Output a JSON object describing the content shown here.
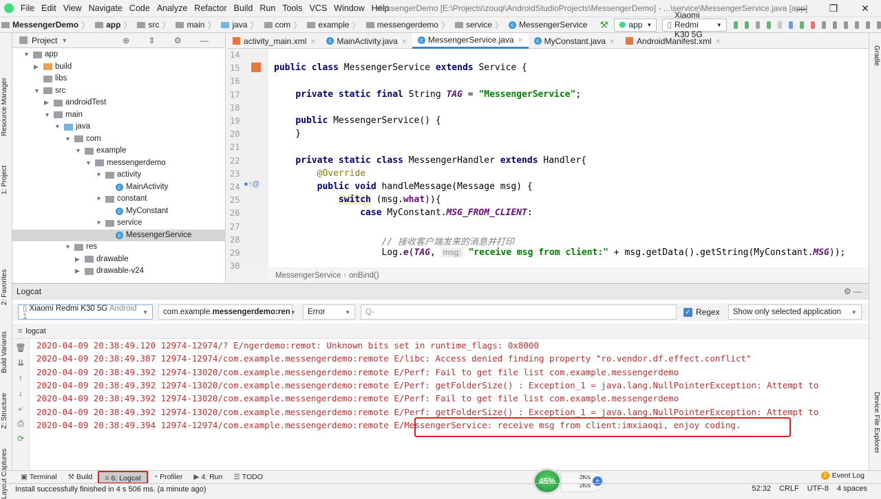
{
  "menu": [
    "File",
    "Edit",
    "View",
    "Navigate",
    "Code",
    "Analyze",
    "Refactor",
    "Build",
    "Run",
    "Tools",
    "VCS",
    "Window",
    "Help"
  ],
  "window_title": "MessengerDemo [E:\\Projects\\zouqi\\AndroidStudioProjects\\MessengerDemo] - ...\\service\\MessengerService.java [app]",
  "breadcrumb": [
    "MessengerDemo",
    "app",
    "src",
    "main",
    "java",
    "com",
    "example",
    "messengerdemo",
    "service",
    "MessengerService"
  ],
  "toolbar": {
    "run_config": "app",
    "device": "Xiaomi Redmi K30 5G"
  },
  "left_strip": [
    "Resource Manager",
    "1: Project",
    "2: Favorites",
    "Build Variants",
    "Z: Structure",
    "Layout Captures"
  ],
  "right_strip": [
    "Gradle",
    "Device File Explorer"
  ],
  "project": {
    "header": "Project",
    "tree": [
      {
        "label": "app",
        "level": 0,
        "type": "module",
        "open": true
      },
      {
        "label": "build",
        "level": 1,
        "type": "folder-orange",
        "open": false
      },
      {
        "label": "libs",
        "level": 1,
        "type": "folder",
        "open": null
      },
      {
        "label": "src",
        "level": 1,
        "type": "folder",
        "open": true
      },
      {
        "label": "androidTest",
        "level": 2,
        "type": "folder",
        "open": false
      },
      {
        "label": "main",
        "level": 2,
        "type": "folder",
        "open": true
      },
      {
        "label": "java",
        "level": 3,
        "type": "folder-blue",
        "open": true
      },
      {
        "label": "com",
        "level": 4,
        "type": "folder",
        "open": true
      },
      {
        "label": "example",
        "level": 5,
        "type": "folder",
        "open": true
      },
      {
        "label": "messengerdemo",
        "level": 6,
        "type": "folder",
        "open": true
      },
      {
        "label": "activity",
        "level": 7,
        "type": "folder",
        "open": true
      },
      {
        "label": "MainActivity",
        "level": 8,
        "type": "class",
        "open": null
      },
      {
        "label": "constant",
        "level": 7,
        "type": "folder",
        "open": true
      },
      {
        "label": "MyConstant",
        "level": 8,
        "type": "class",
        "open": null
      },
      {
        "label": "service",
        "level": 7,
        "type": "folder",
        "open": true
      },
      {
        "label": "MessengerService",
        "level": 8,
        "type": "class",
        "open": null,
        "selected": true
      },
      {
        "label": "res",
        "level": 4,
        "type": "folder",
        "open": true
      },
      {
        "label": "drawable",
        "level": 5,
        "type": "folder",
        "open": false
      },
      {
        "label": "drawable-v24",
        "level": 5,
        "type": "folder",
        "open": false
      }
    ]
  },
  "tabs": [
    {
      "label": "activity_main.xml"
    },
    {
      "label": "MainActivity.java"
    },
    {
      "label": "MessengerService.java",
      "active": true
    },
    {
      "label": "MyConstant.java"
    },
    {
      "label": "AndroidManifest.xml"
    }
  ],
  "code": {
    "first_line": 14,
    "lines": [
      [],
      [
        [
          "kw",
          "public class "
        ],
        [
          "",
          "MessengerService "
        ],
        [
          "kw",
          "extends "
        ],
        [
          "",
          "Service {"
        ]
      ],
      [],
      [
        [
          "",
          "    "
        ],
        [
          "kw",
          "private static final "
        ],
        [
          "",
          "String "
        ],
        [
          "it",
          "TAG"
        ],
        [
          "",
          " = "
        ],
        [
          "str",
          "\"MessengerService\""
        ],
        [
          "",
          ";"
        ]
      ],
      [],
      [
        [
          "",
          "    "
        ],
        [
          "kw",
          "public "
        ],
        [
          "",
          "MessengerService() {"
        ]
      ],
      [
        [
          "",
          "    }"
        ]
      ],
      [],
      [
        [
          "",
          "    "
        ],
        [
          "kw",
          "private static class "
        ],
        [
          "",
          "MessengerHandler "
        ],
        [
          "kw",
          "extends "
        ],
        [
          "",
          "Handler{"
        ]
      ],
      [
        [
          "",
          "        "
        ],
        [
          "ann",
          "@Override"
        ]
      ],
      [
        [
          "",
          "        "
        ],
        [
          "kw",
          "public void "
        ],
        [
          "",
          "handleMessage(Message msg) {"
        ]
      ],
      [
        [
          "",
          "            "
        ],
        [
          "kw hl",
          "switch"
        ],
        [
          "",
          " (msg."
        ],
        [
          "fld",
          "what"
        ],
        [
          "",
          ")){"
        ]
      ],
      [
        [
          "",
          "                "
        ],
        [
          "kw",
          "case "
        ],
        [
          "",
          "MyConstant."
        ],
        [
          "it",
          "MSG_FROM_CLIENT"
        ],
        [
          "",
          ":"
        ]
      ],
      [],
      [
        [
          "",
          "                    "
        ],
        [
          "cm",
          "// 接收客户端发来的消息并打印"
        ]
      ],
      [
        [
          "",
          "                    Log."
        ],
        [
          "it",
          "e"
        ],
        [
          "",
          "("
        ],
        [
          "it",
          "TAG"
        ],
        [
          "",
          ", "
        ],
        [
          "hint",
          "msg:"
        ],
        [
          "str",
          " \"receive msg from client:\""
        ],
        [
          "",
          " + msg.getData().getString(MyConstant."
        ],
        [
          "it",
          "MSG"
        ],
        [
          "",
          "));"
        ]
      ],
      []
    ]
  },
  "editor_breadcrumb": [
    "MessengerService",
    "onBind()"
  ],
  "logcat": {
    "title": "Logcat",
    "device": "Xiaomi Redmi K30 5G",
    "device_suffix": "Android 1",
    "process_prefix": "com.example.",
    "process_bold": "messengerdemo:ren",
    "level": "Error",
    "search_placeholder": "Q-",
    "regex_label": "Regex",
    "regex_checked": true,
    "filter": "Show only selected application",
    "tab": "logcat",
    "lines": [
      "2020-04-09 20:38:49.120 12974-12974/? E/ngerdemo:remot: Unknown bits set in runtime_flags: 0x8000",
      "2020-04-09 20:38:49.387 12974-12974/com.example.messengerdemo:remote E/libc: Access denied finding property \"ro.vendor.df.effect.conflict\"",
      "2020-04-09 20:38:49.392 12974-13020/com.example.messengerdemo:remote E/Perf: Fail to get file list com.example.messengerdemo",
      "2020-04-09 20:38:49.392 12974-13020/com.example.messengerdemo:remote E/Perf: getFolderSize() : Exception_1 = java.lang.NullPointerException: Attempt to",
      "2020-04-09 20:38:49.392 12974-13020/com.example.messengerdemo:remote E/Perf: Fail to get file list com.example.messengerdemo",
      "2020-04-09 20:38:49.392 12974-13020/com.example.messengerdemo:remote E/Perf: getFolderSize() : Exception_1 = java.lang.NullPointerException: Attempt to",
      "2020-04-09 20:38:49.394 12974-12974/com.example.messengerdemo:remote E/MessengerService: receive msg from client:imxiaoqi, enjoy coding."
    ]
  },
  "tool_tabs": [
    {
      "label": "Terminal"
    },
    {
      "label": "Build"
    },
    {
      "label": "6: Logcat",
      "active": true
    },
    {
      "label": "Profiler"
    },
    {
      "label": "4: Run"
    },
    {
      "label": "TODO"
    }
  ],
  "event_log": {
    "label": "Event Log",
    "count": "2"
  },
  "monitor": {
    "cpu": "45%",
    "up": "2K/s",
    "down": "2K/s"
  },
  "status": {
    "message": "Install successfully finished in 4 s 506 ms. (a minute ago)",
    "position": "52:32",
    "line_sep": "CRLF",
    "encoding": "UTF-8",
    "indent": "4 spaces"
  },
  "colors": {
    "accent": "#4083c9",
    "log_error": "#c03030",
    "highlight_box": "#e02020"
  }
}
